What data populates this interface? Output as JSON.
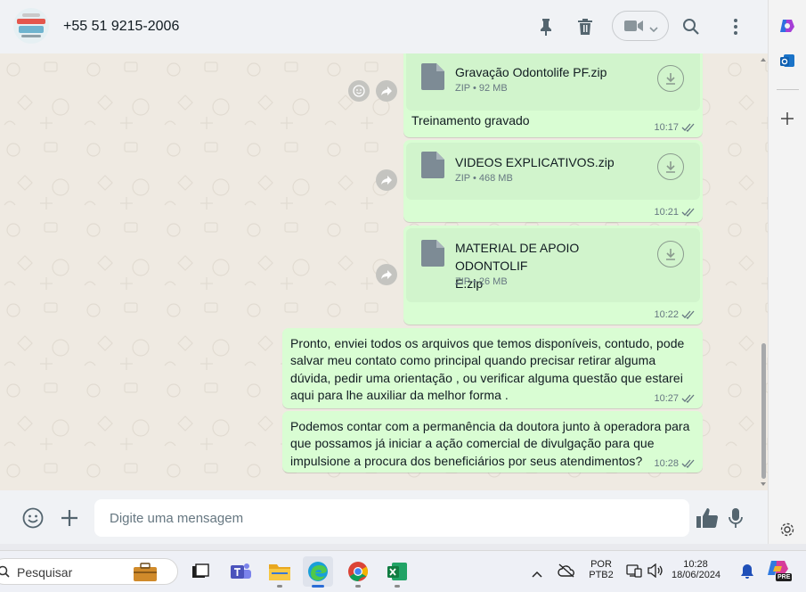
{
  "header": {
    "contact": "+55 51 9215-2006"
  },
  "messages": [
    {
      "kind": "file",
      "name": "Gravação Odontolife PF.zip",
      "meta": "ZIP • 92 MB",
      "caption": "Treinamento gravado",
      "time": "10:17"
    },
    {
      "kind": "file",
      "name": "VIDEOS EXPLICATIVOS.zip",
      "meta": "ZIP • 468 MB",
      "time": "10:21"
    },
    {
      "kind": "file",
      "name_line1": "MATERIAL DE APOIO ODONTOLIF",
      "name_line2": "E.zip",
      "meta": "ZIP • 26 MB",
      "time": "10:22"
    },
    {
      "kind": "text",
      "lines": [
        "Pronto, enviei todos os arquivos que temos disponíveis, contudo, pode",
        "salvar meu contato como principal quando precisar retirar alguma",
        "dúvida, pedir uma orientação , ou verificar alguma questão que estarei",
        "aqui para lhe auxiliar da melhor forma ."
      ],
      "time": "10:27"
    },
    {
      "kind": "text",
      "lines": [
        "Podemos contar com a permanência da doutora junto à operadora para",
        "que possamos já iniciar a ação comercial de divulgação para que",
        "impulsione a procura dos beneficiários por seus atendimentos?"
      ],
      "time": "10:28"
    }
  ],
  "composer": {
    "placeholder": "Digite uma mensagem"
  },
  "taskbar": {
    "search_label": "Pesquisar",
    "lang_line1": "POR",
    "lang_line2": "PTB2",
    "clock_time": "10:28",
    "clock_date": "18/06/2024",
    "copilot_badge": "PRE"
  },
  "colors": {
    "outgoing_bubble": "#d9fdd3",
    "file_card": "#d1f4cc",
    "chat_bg": "#efeae2",
    "header_bg": "#f0f2f5",
    "read_ticks": "#667781"
  },
  "icons": [
    "pin-icon",
    "trash-icon",
    "video-call-icon",
    "chevron-down-icon",
    "search-icon",
    "menu-icon",
    "emoji-icon",
    "plus-icon",
    "mic-icon",
    "thumbs-up-icon",
    "forward-icon",
    "reaction-icon",
    "download-icon",
    "document-icon",
    "double-check-icon"
  ]
}
